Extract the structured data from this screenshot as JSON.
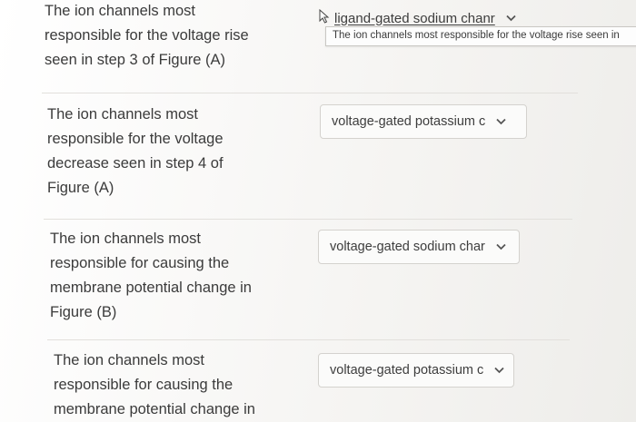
{
  "questions": [
    {
      "text_lines": [
        "The ion channels most",
        "responsible for the voltage rise",
        "seen in step 3 of Figure (A)"
      ],
      "selected": "ligand-gated sodium chanr",
      "tooltip": "The ion channels most responsible for the voltage rise seen in"
    },
    {
      "text_lines": [
        "The ion channels most",
        "responsible for the voltage",
        "decrease seen in step 4 of",
        "Figure (A)"
      ],
      "selected": "voltage-gated potassium c"
    },
    {
      "text_lines": [
        "The ion channels most",
        "responsible for causing the",
        "membrane potential change in",
        "Figure (B)"
      ],
      "selected": "voltage-gated sodium char"
    },
    {
      "text_lines": [
        "The ion channels most",
        "responsible for causing the",
        "membrane potential change in"
      ],
      "selected": "voltage-gated potassium c"
    }
  ],
  "icons": {
    "dropdown": "chevron-down-icon",
    "cursor": "pointer-cursor-icon"
  },
  "colors": {
    "text": "#3b3b3b",
    "border": "#d4d2ce",
    "background": "#ffffff"
  }
}
